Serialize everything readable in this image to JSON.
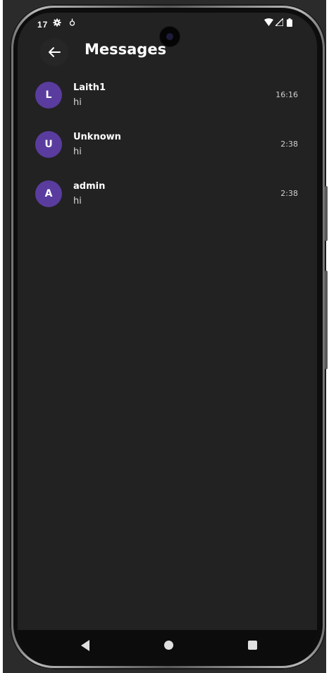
{
  "status_bar": {
    "time": "17",
    "icons": [
      "settings-icon",
      "notification-icon",
      "wifi-icon",
      "signal-icon",
      "battery-icon"
    ]
  },
  "app_bar": {
    "back_icon": "arrow-left-icon",
    "title": "Messages"
  },
  "conversations": [
    {
      "initial": "L",
      "name": "Laith1",
      "preview": "hi",
      "time": "16:16"
    },
    {
      "initial": "U",
      "name": "Unknown",
      "preview": "hi",
      "time": "2:38"
    },
    {
      "initial": "A",
      "name": "admin",
      "preview": "hi",
      "time": "2:38"
    }
  ],
  "navigation": {
    "buttons": [
      "nav-back-icon",
      "nav-home-icon",
      "nav-recents-icon"
    ]
  },
  "colors": {
    "background": "#222222",
    "avatar": "#5a3c9e",
    "text_primary": "#ffffff"
  }
}
